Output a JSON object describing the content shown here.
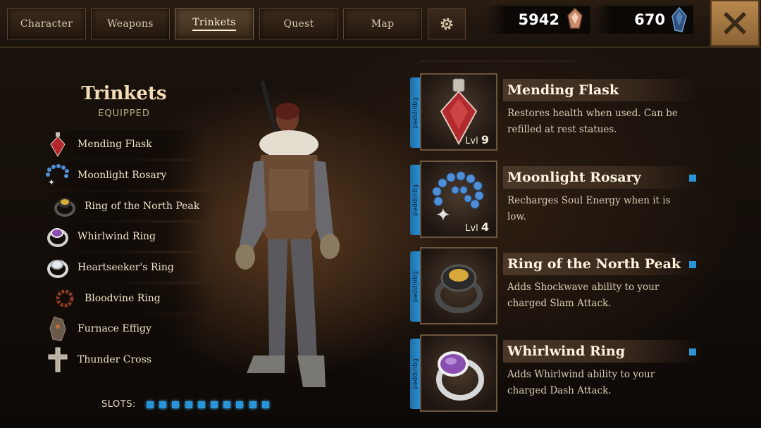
{
  "tabs": [
    {
      "label": "Character",
      "active": false
    },
    {
      "label": "Weapons",
      "active": false
    },
    {
      "label": "Trinkets",
      "active": true
    },
    {
      "label": "Quest",
      "active": false
    },
    {
      "label": "Map",
      "active": false
    }
  ],
  "settings_icon": "gear-icon",
  "currency": {
    "gold": {
      "amount": "5942",
      "icon": "gold-crystal-icon"
    },
    "gems": {
      "amount": "670",
      "icon": "blue-gem-icon"
    }
  },
  "close_icon": "close-x-icon",
  "left_panel": {
    "title": "Trinkets",
    "subtitle": "EQUIPPED",
    "items": [
      {
        "label": "Mending Flask",
        "icon": "flask-icon"
      },
      {
        "label": "Moonlight Rosary",
        "icon": "rosary-icon"
      },
      {
        "label": "Ring of the North Peak",
        "icon": "ring-gold-icon"
      },
      {
        "label": "Whirlwind Ring",
        "icon": "ring-purple-icon"
      },
      {
        "label": "Heartseeker's Ring",
        "icon": "ring-silver-icon"
      },
      {
        "label": "Bloodvine Ring",
        "icon": "ring-vine-icon"
      },
      {
        "label": "Furnace Effigy",
        "icon": "effigy-icon"
      },
      {
        "label": "Thunder Cross",
        "icon": "cross-icon"
      }
    ],
    "slots_label": "SLOTS:",
    "slots_filled": 10
  },
  "cards": [
    {
      "equipped": "Equipped",
      "name": "Mending Flask",
      "desc": "Restores health when used. Can be refilled at rest statues.",
      "lvl_label": "Lvl",
      "lvl": "9",
      "icon": "flask-icon",
      "dot": false
    },
    {
      "equipped": "Equipped",
      "name": "Moonlight Rosary",
      "desc": "Recharges Soul Energy when it is low.",
      "lvl_label": "Lvl",
      "lvl": "4",
      "icon": "rosary-icon",
      "dot": true
    },
    {
      "equipped": "Equipped",
      "name": "Ring of the North Peak",
      "desc": "Adds Shockwave ability to your charged Slam Attack.",
      "lvl_label": "",
      "lvl": "",
      "icon": "ring-gold-icon",
      "dot": true
    },
    {
      "equipped": "Equipped",
      "name": "Whirlwind Ring",
      "desc": "Adds Whirlwind ability to your charged Dash Attack.",
      "lvl_label": "",
      "lvl": "",
      "icon": "ring-purple-icon",
      "dot": true
    }
  ],
  "colors": {
    "accent_blue": "#2a95d6",
    "gold": "#b8894d"
  }
}
